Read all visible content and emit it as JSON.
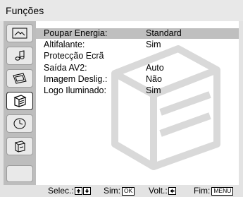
{
  "title": "Funções",
  "sidebar": {
    "items": [
      {
        "icon": "picture-icon"
      },
      {
        "icon": "sound-icon"
      },
      {
        "icon": "screen-icon"
      },
      {
        "icon": "functions-icon",
        "selected": true
      },
      {
        "icon": "clock-icon"
      },
      {
        "icon": "settings-icon"
      }
    ]
  },
  "menu": {
    "rows": [
      {
        "label": "Poupar Energia:",
        "value": "Standard",
        "highlighted": true
      },
      {
        "label": "Altifalante:",
        "value": "Sim"
      },
      {
        "label": "Protecção Ecrã",
        "value": ""
      },
      {
        "label": "Saída AV2:",
        "value": "Auto"
      },
      {
        "label": "Imagem Deslig.:",
        "value": "Não"
      },
      {
        "label": "Logo Iluminado:",
        "value": "Sim"
      }
    ]
  },
  "footer": {
    "select_label": "Selec.:",
    "ok_label": "Sim:",
    "ok_key": "OK",
    "back_label": "Volt.:",
    "end_label": "Fim:",
    "menu_key": "MENU"
  },
  "colors": {
    "background": "#e3e3e3",
    "sidebar": "#bdbdbd",
    "highlight": "#bfbfbf",
    "content": "#ffffff"
  }
}
